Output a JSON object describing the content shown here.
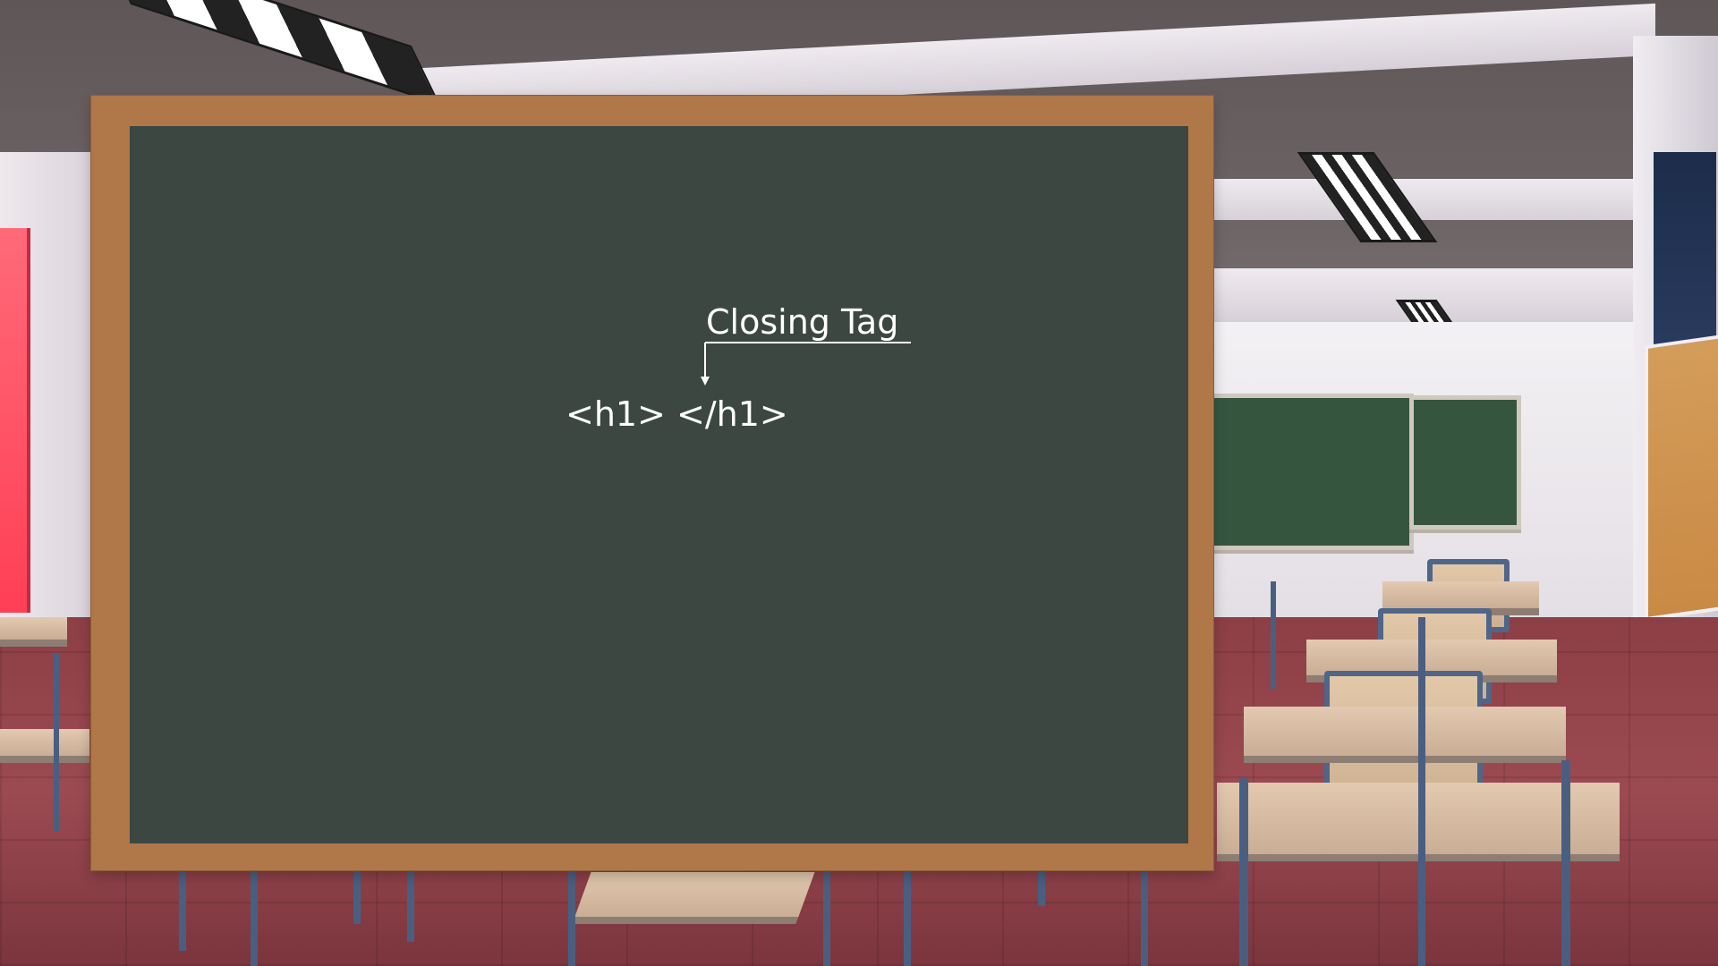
{
  "board": {
    "label": "Closing Tag",
    "code": "<h1> </h1>"
  },
  "icons": {
    "pointer": "arrow-down-icon"
  },
  "colors": {
    "board": "#3c4741",
    "frame": "#b07749",
    "chalk": "#ffffff"
  }
}
